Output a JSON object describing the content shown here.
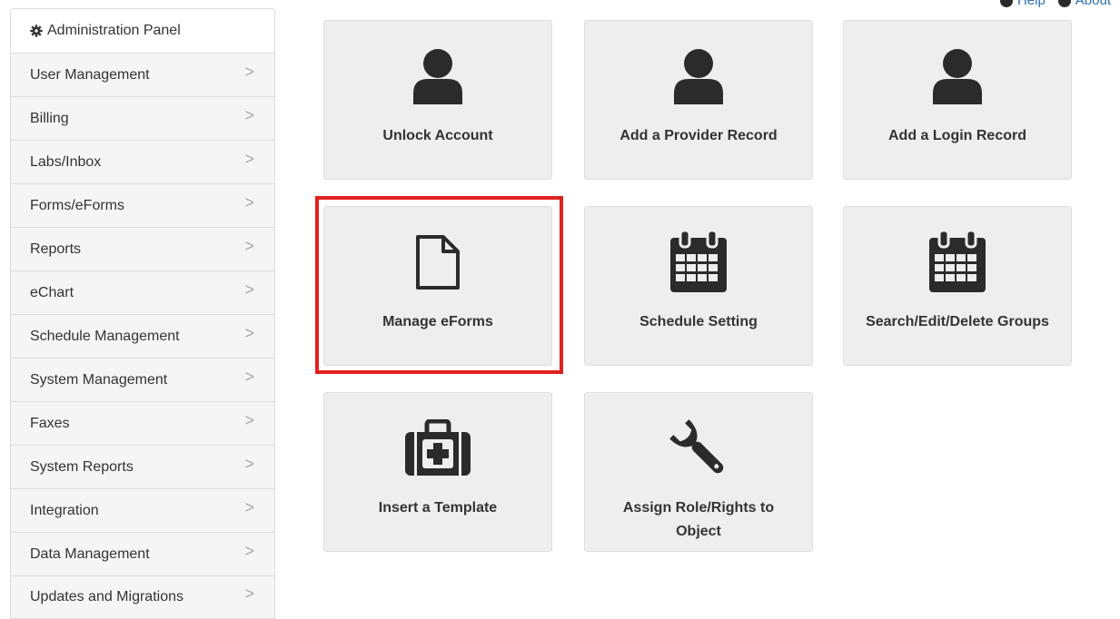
{
  "top_links": [
    {
      "label": "Help",
      "icon": "help-icon"
    },
    {
      "label": "About",
      "icon": "info-icon"
    }
  ],
  "sidebar": {
    "header": {
      "label": "Administration Panel",
      "icon": "gear-icon"
    },
    "items": [
      {
        "label": "User Management"
      },
      {
        "label": "Billing"
      },
      {
        "label": "Labs/Inbox"
      },
      {
        "label": "Forms/eForms"
      },
      {
        "label": "Reports"
      },
      {
        "label": "eChart"
      },
      {
        "label": "Schedule Management"
      },
      {
        "label": "System Management"
      },
      {
        "label": "Faxes"
      },
      {
        "label": "System Reports"
      },
      {
        "label": "Integration"
      },
      {
        "label": "Data Management"
      },
      {
        "label": "Updates and Migrations"
      }
    ],
    "chevron": ">"
  },
  "tiles": [
    {
      "label": "Unlock Account",
      "icon": "user-icon"
    },
    {
      "label": "Add a Provider Record",
      "icon": "user-icon"
    },
    {
      "label": "Add a Login Record",
      "icon": "user-icon"
    },
    {
      "label": "Manage eForms",
      "icon": "document-icon",
      "highlighted": true
    },
    {
      "label": "Schedule Setting",
      "icon": "calendar-icon"
    },
    {
      "label": "Search/Edit/Delete Groups",
      "icon": "calendar-icon"
    },
    {
      "label": "Insert a Template",
      "icon": "medical-kit-icon"
    },
    {
      "label": "Assign Role/Rights to Object",
      "icon": "wrench-icon"
    }
  ],
  "colors": {
    "highlight": "#e2211c",
    "tile_bg": "#eeeeee",
    "link": "#2a6fb0",
    "icon": "#2b2b2b"
  }
}
